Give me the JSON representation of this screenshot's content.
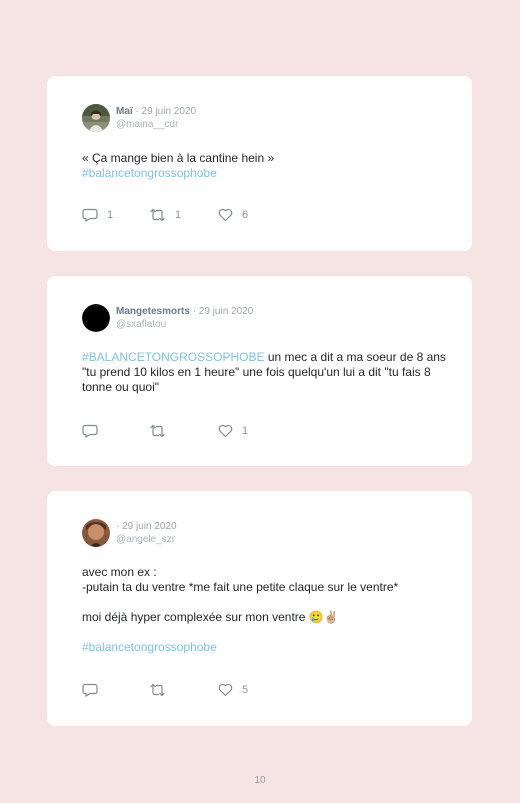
{
  "tweets": [
    {
      "author": "Maï",
      "date": "· 29 juin 2020",
      "handle": "@maina__cdr",
      "text": "« Ça mange bien à la cantine hein »",
      "hashtag": "#balancetongrossophobe",
      "replies": "1",
      "retweets": "1",
      "likes": "6"
    },
    {
      "author": "Mangetesmorts",
      "date": "· 29 juin 2020",
      "handle": "@sxaflatou",
      "hashtag": "#BALANCETONGROSSOPHOBE",
      "text": " un mec a dit a ma soeur de 8 ans \"tu prend 10 kilos en 1 heure\" une fois quelqu'un lui a dit \"tu fais 8 tonne ou quoi\"",
      "replies": "",
      "retweets": "",
      "likes": "1"
    },
    {
      "author": "",
      "date": "· 29 juin 2020",
      "handle": "@angele_szr",
      "line1": "avec mon ex :",
      "line2": "-putain ta du ventre *me fait une petite claque sur le ventre*",
      "line3": "moi déjà hyper complexée sur mon ventre 🥲✌🏼",
      "hashtag": "#balancetongrossophobe",
      "replies": "",
      "retweets": "",
      "likes": "5"
    }
  ],
  "page_number": "10",
  "colors": {
    "background": "#f6e4e4",
    "card": "#ffffff",
    "hashtag": "#7cc3e3",
    "meta": "#9aa5ad"
  },
  "icons": [
    "reply-icon",
    "retweet-icon",
    "heart-icon"
  ]
}
